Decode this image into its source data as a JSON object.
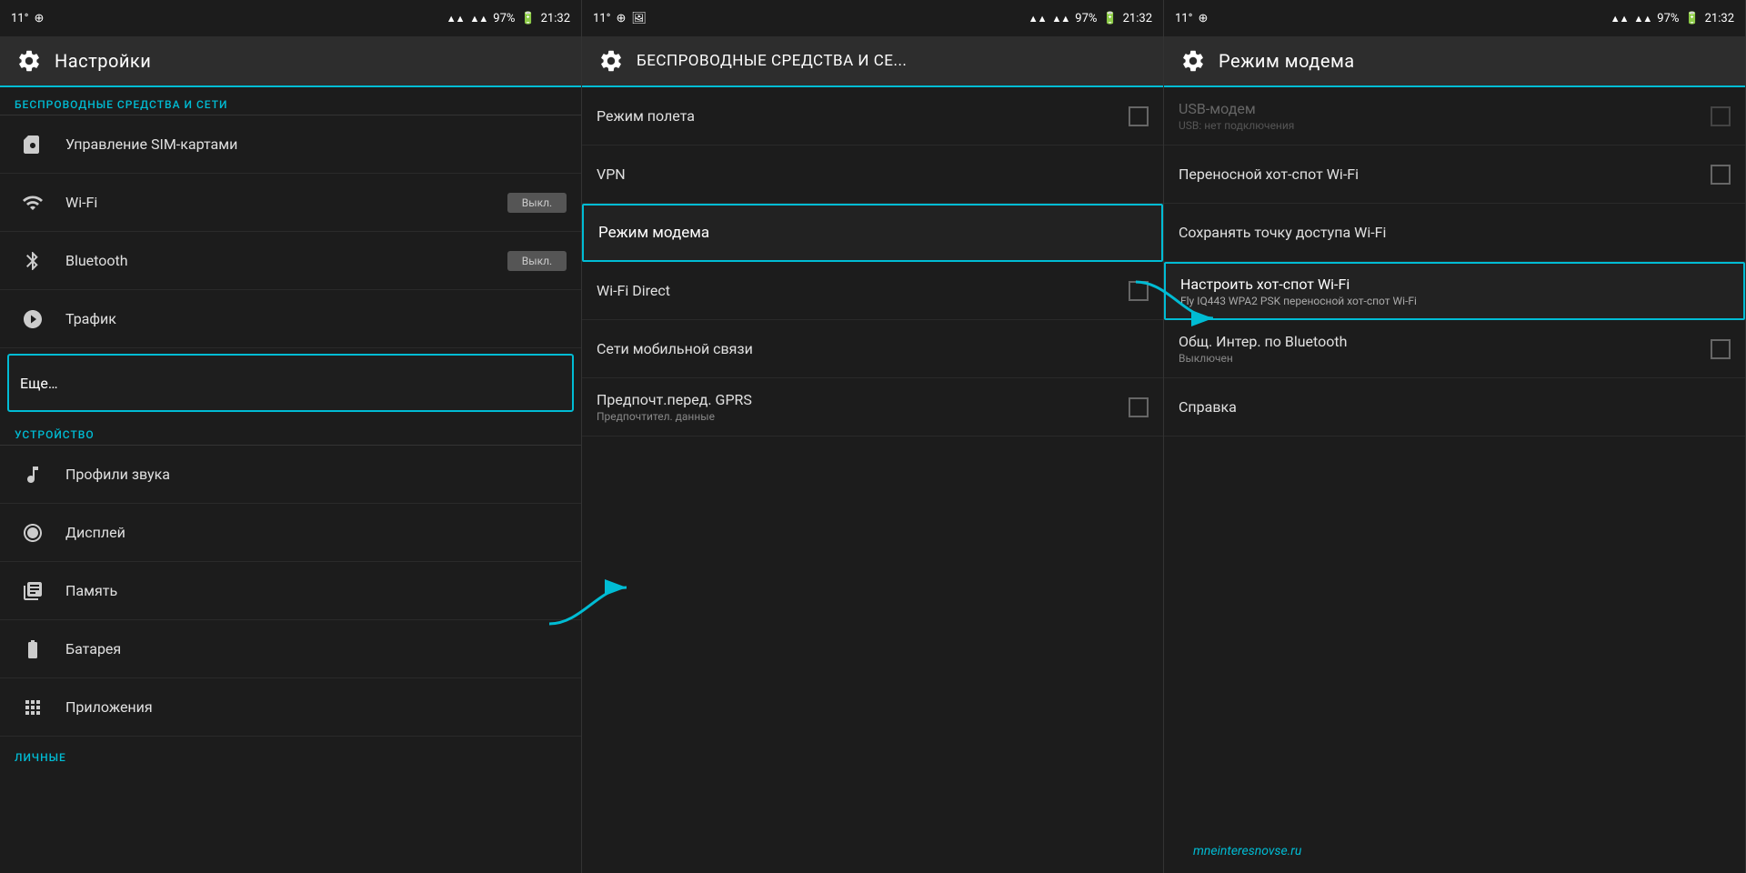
{
  "panels": [
    {
      "id": "panel1",
      "statusBar": {
        "left": [
          "11°",
          "⊕"
        ],
        "signal": "▲▲ ▲▲",
        "battery": "97%",
        "time": "21:32"
      },
      "titleBar": {
        "icon": "gear",
        "title": "Настройки"
      },
      "sections": [
        {
          "header": "БЕСПРОВОДНЫЕ СРЕДСТВА И СЕТИ",
          "items": [
            {
              "id": "sim",
              "icon": "sim",
              "text": "Управление SIM-картами",
              "toggle": null,
              "highlighted": false
            },
            {
              "id": "wifi",
              "icon": "wifi",
              "text": "Wi-Fi",
              "toggle": "Выкл.",
              "highlighted": false
            },
            {
              "id": "bluetooth",
              "icon": "bluetooth",
              "text": "Bluetooth",
              "toggle": "Выкл.",
              "highlighted": false
            },
            {
              "id": "traffic",
              "icon": "traffic",
              "text": "Трафик",
              "toggle": null,
              "highlighted": false
            },
            {
              "id": "more",
              "icon": null,
              "text": "Еще…",
              "toggle": null,
              "highlighted": true
            }
          ]
        },
        {
          "header": "УСТРОЙСТВО",
          "items": [
            {
              "id": "sound",
              "icon": "sound",
              "text": "Профили звука",
              "toggle": null,
              "highlighted": false
            },
            {
              "id": "display",
              "icon": "display",
              "text": "Дисплей",
              "toggle": null,
              "highlighted": false
            },
            {
              "id": "memory",
              "icon": "memory",
              "text": "Память",
              "toggle": null,
              "highlighted": false
            },
            {
              "id": "battery",
              "icon": "battery",
              "text": "Батарея",
              "toggle": null,
              "highlighted": false
            },
            {
              "id": "apps",
              "icon": "apps",
              "text": "Приложения",
              "toggle": null,
              "highlighted": false
            }
          ]
        }
      ],
      "footer": "ЛИЧНЫЕ"
    },
    {
      "id": "panel2",
      "statusBar": {
        "left": [
          "11°",
          "⊕",
          "🖼"
        ],
        "signal": "▲▲ ▲▲",
        "battery": "97%",
        "time": "21:32"
      },
      "titleBar": {
        "icon": "gear",
        "title": "БЕСПРОВОДНЫЕ СРЕДСТВА И СЕ..."
      },
      "items": [
        {
          "id": "airplane",
          "text": "Режим полета",
          "subtitle": null,
          "checkbox": true,
          "highlighted": false
        },
        {
          "id": "vpn",
          "text": "VPN",
          "subtitle": null,
          "checkbox": false,
          "highlighted": false
        },
        {
          "id": "modem",
          "text": "Режим модема",
          "subtitle": null,
          "checkbox": false,
          "highlighted": true
        },
        {
          "id": "wifidirect",
          "text": "Wi-Fi Direct",
          "subtitle": null,
          "checkbox": true,
          "highlighted": false
        },
        {
          "id": "mobile",
          "text": "Сети мобильной связи",
          "subtitle": null,
          "checkbox": false,
          "highlighted": false
        },
        {
          "id": "gprs",
          "text": "Предпочт.перед. GPRS",
          "subtitle": "Предпочтител. данные",
          "checkbox": true,
          "highlighted": false
        }
      ]
    },
    {
      "id": "panel3",
      "statusBar": {
        "left": [
          "11°",
          "⊕"
        ],
        "signal": "▲▲ ▲▲",
        "battery": "97%",
        "time": "21:32"
      },
      "titleBar": {
        "icon": "gear",
        "title": "Режим модема"
      },
      "items": [
        {
          "id": "usb",
          "text": "USB-модем",
          "subtitle": "USB: нет подключения",
          "checkbox": true,
          "highlighted": false,
          "greyed": true
        },
        {
          "id": "hotspot",
          "text": "Переносной хот-спот Wi-Fi",
          "subtitle": null,
          "checkbox": true,
          "highlighted": false,
          "greyed": false
        },
        {
          "id": "save-hotspot",
          "text": "Сохранять точку доступа Wi-Fi",
          "subtitle": null,
          "checkbox": false,
          "highlighted": false,
          "greyed": false
        },
        {
          "id": "configure-hotspot",
          "text": "Настроить хот-спот Wi-Fi",
          "subtitle": "Fly IQ443 WPA2 PSK переносной хот-спот Wi-Fi",
          "checkbox": false,
          "highlighted": true,
          "greyed": false
        },
        {
          "id": "bluetooth-tether",
          "text": "Общ. Интер. по Bluetooth",
          "subtitle": "Выключен",
          "checkbox": true,
          "highlighted": false,
          "greyed": false
        },
        {
          "id": "help",
          "text": "Справка",
          "subtitle": null,
          "checkbox": false,
          "highlighted": false,
          "greyed": false
        }
      ],
      "brand": "mneinteresnovse.ru"
    }
  ],
  "arrows": [
    {
      "from": "panel1-more",
      "to": "panel2-modem",
      "label": ""
    },
    {
      "from": "panel2-modem",
      "to": "panel3-configure",
      "label": ""
    }
  ]
}
